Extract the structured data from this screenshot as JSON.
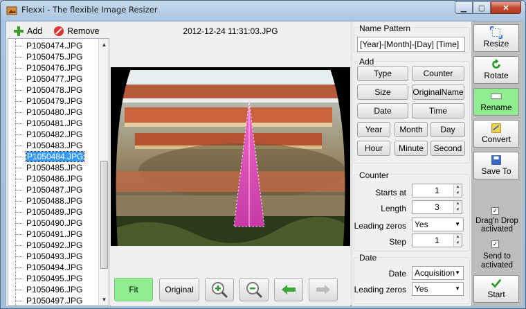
{
  "window": {
    "title": "Flexxi - The flexible Image Resizer"
  },
  "list_toolbar": {
    "add_label": "Add",
    "remove_label": "Remove"
  },
  "files": [
    "P1050474.JPG",
    "P1050475.JPG",
    "P1050476.JPG",
    "P1050477.JPG",
    "P1050478.JPG",
    "P1050479.JPG",
    "P1050480.JPG",
    "P1050481.JPG",
    "P1050482.JPG",
    "P1050483.JPG",
    "P1050484.JPG",
    "P1050485.JPG",
    "P1050486.JPG",
    "P1050487.JPG",
    "P1050488.JPG",
    "P1050489.JPG",
    "P1050490.JPG",
    "P1050491.JPG",
    "P1050492.JPG",
    "P1050493.JPG",
    "P1050494.JPG",
    "P1050495.JPG",
    "P1050496.JPG",
    "P1050497.JPG"
  ],
  "selected_file": "P1050484.JPG",
  "preview": {
    "filename": "2012-12-24 11:31:03.JPG"
  },
  "view_toolbar": {
    "fit_label": "Fit",
    "original_label": "Original"
  },
  "name_pattern": {
    "group_label": "Name Pattern",
    "value": "[Year]-[Month]-[Day] [Time]"
  },
  "add_group": {
    "label": "Add",
    "buttons": [
      "Type",
      "Counter",
      "Size",
      "OriginalName",
      "Date",
      "Time",
      "Year",
      "Month",
      "Day",
      "Hour",
      "Minute",
      "Second"
    ]
  },
  "counter": {
    "label": "Counter",
    "starts_at_label": "Starts at",
    "starts_at": "1",
    "length_label": "Length",
    "length": "3",
    "leading_zeros_label": "Leading zeros",
    "leading_zeros": "Yes",
    "step_label": "Step",
    "step": "1"
  },
  "date": {
    "label": "Date",
    "date_label": "Date",
    "date_value": "Acquisition",
    "leading_zeros_label": "Leading zeros",
    "leading_zeros": "Yes"
  },
  "actions": {
    "resize": "Resize",
    "rotate": "Rotate",
    "rename": "Rename",
    "convert": "Convert",
    "save_to": "Save To",
    "start": "Start"
  },
  "options": {
    "drag_drop_line1": "Drag'n Drop",
    "drag_drop_line2": "activated",
    "drag_drop_checked": true,
    "send_to_line1": "Send to",
    "send_to_line2": "activated",
    "send_to_checked": true
  },
  "colors": {
    "active_green": "#90ee90",
    "selection_blue": "#3399ff"
  }
}
